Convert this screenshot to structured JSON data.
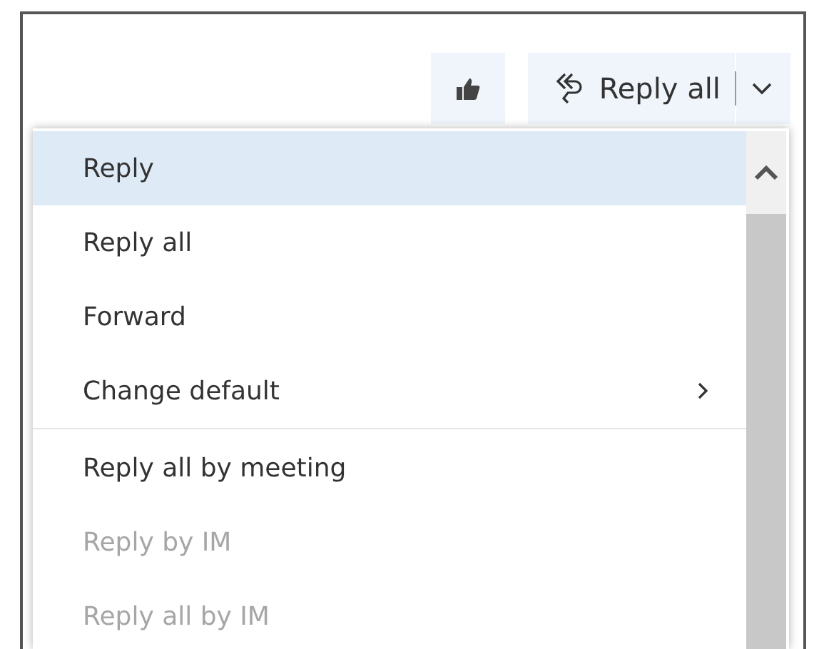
{
  "toolbar": {
    "reply_button": {
      "label": "Reply all"
    }
  },
  "menu": {
    "items": [
      {
        "label": "Reply",
        "selected": true,
        "disabled": false,
        "kind": "plain"
      },
      {
        "label": "Reply all",
        "selected": false,
        "disabled": false,
        "kind": "plain"
      },
      {
        "label": "Forward",
        "selected": false,
        "disabled": false,
        "kind": "plain"
      },
      {
        "label": "Change default",
        "selected": false,
        "disabled": false,
        "kind": "submenu"
      },
      {
        "label": "Reply all by meeting",
        "selected": false,
        "disabled": false,
        "kind": "plain",
        "separator_before": true
      },
      {
        "label": "Reply by IM",
        "selected": false,
        "disabled": true,
        "kind": "plain"
      },
      {
        "label": "Reply all by IM",
        "selected": false,
        "disabled": true,
        "kind": "plain"
      }
    ]
  }
}
